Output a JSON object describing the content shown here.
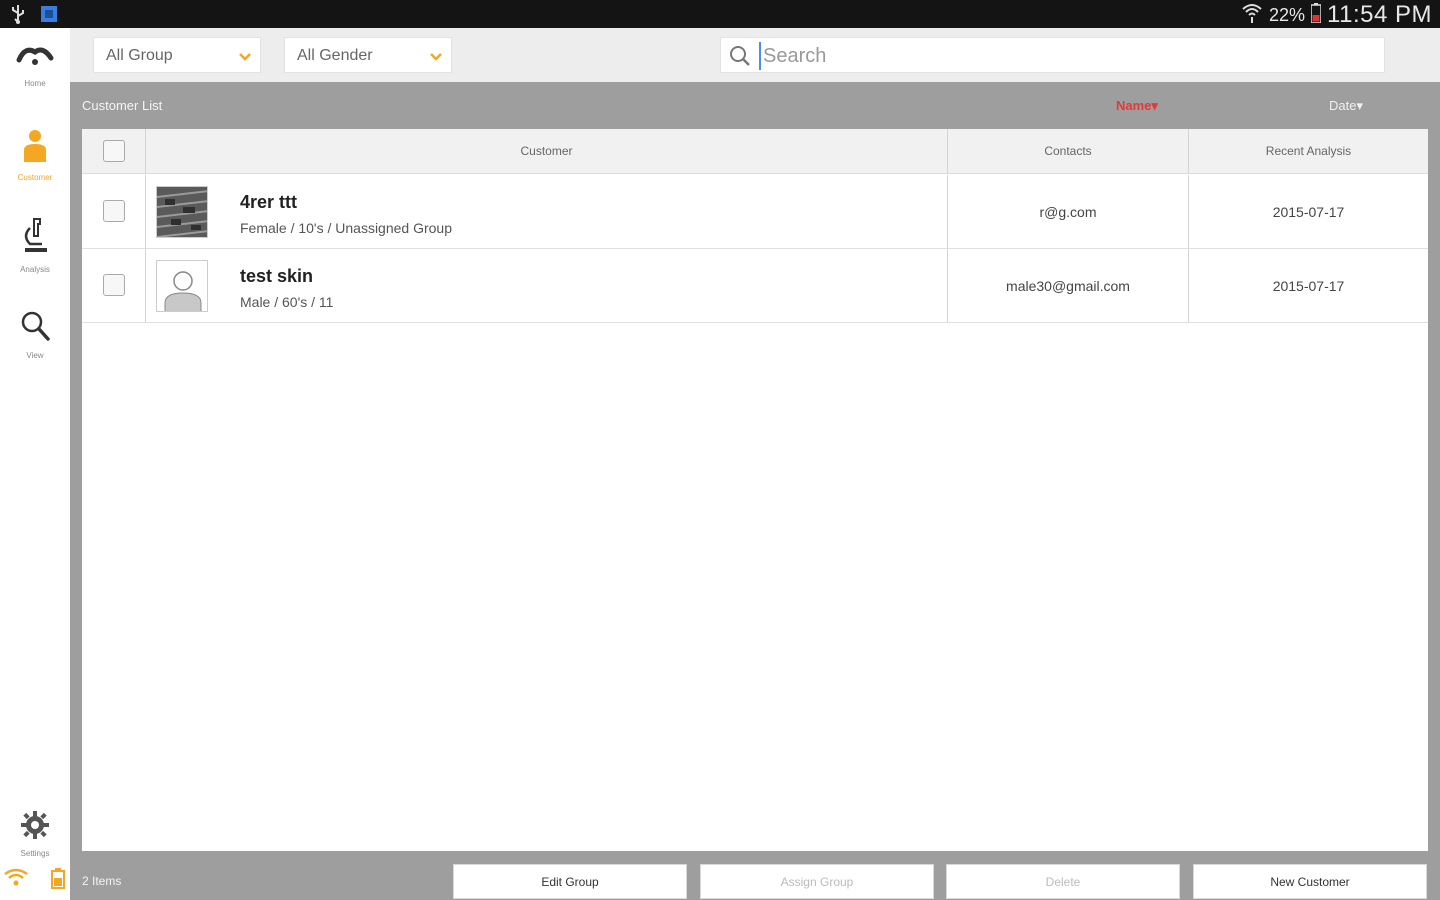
{
  "status_bar": {
    "battery_percent": "22%",
    "time": "11:54 PM",
    "icons": [
      "usb-icon",
      "app-notification-icon",
      "wifi-icon",
      "battery-icon"
    ]
  },
  "sidebar": {
    "items": [
      {
        "label": "Home",
        "icon": "home-logo-icon",
        "active": false
      },
      {
        "label": "Customer",
        "icon": "person-icon",
        "active": true
      },
      {
        "label": "Analysis",
        "icon": "microscope-icon",
        "active": false
      },
      {
        "label": "View",
        "icon": "magnifier-icon",
        "active": false
      },
      {
        "label": "Settings",
        "icon": "gear-icon",
        "active": false
      }
    ],
    "accent": "#f5a623"
  },
  "filters": {
    "group_select": "All Group",
    "gender_select": "All Gender",
    "search_placeholder": "Search"
  },
  "list": {
    "title": "Customer List",
    "sort_name": "Name▾",
    "sort_date": "Date▾",
    "sort_active_color": "#e53935",
    "columns": [
      "Customer",
      "Contacts",
      "Recent Analysis"
    ],
    "rows": [
      {
        "name": "4rer ttt",
        "details": "Female / 10's / Unassigned Group",
        "contact": "r@g.com",
        "recent": "2015-07-17",
        "avatar": "photo"
      },
      {
        "name": "test skin",
        "details": "Male / 60's / 11",
        "contact": "male30@gmail.com",
        "recent": "2015-07-17",
        "avatar": "placeholder"
      }
    ]
  },
  "footer": {
    "count": "2 Items",
    "buttons": [
      {
        "label": "Edit Group",
        "enabled": true
      },
      {
        "label": "Assign Group",
        "enabled": false
      },
      {
        "label": "Delete",
        "enabled": false
      },
      {
        "label": "New Customer",
        "enabled": true
      }
    ]
  }
}
